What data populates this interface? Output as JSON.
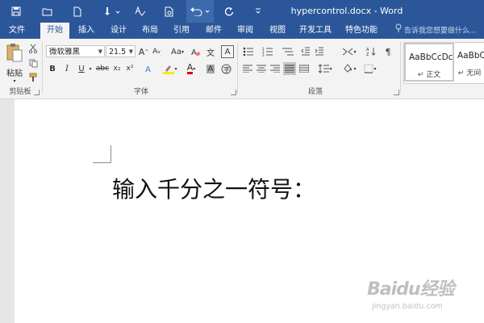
{
  "title_bar": {
    "document_title": "hypercontrol.docx - Word",
    "qat_icons": [
      "save-icon",
      "open-folder-icon",
      "new-document-icon",
      "touch-mode-icon",
      "spelling-icon",
      "print-preview-icon",
      "undo-icon",
      "redo-icon",
      "customize-qat-icon"
    ]
  },
  "tabs": [
    {
      "label": "文件",
      "active": false
    },
    {
      "label": "开始",
      "active": true
    },
    {
      "label": "插入",
      "active": false
    },
    {
      "label": "设计",
      "active": false
    },
    {
      "label": "布局",
      "active": false
    },
    {
      "label": "引用",
      "active": false
    },
    {
      "label": "邮件",
      "active": false
    },
    {
      "label": "审阅",
      "active": false
    },
    {
      "label": "视图",
      "active": false
    },
    {
      "label": "开发工具",
      "active": false
    },
    {
      "label": "特色功能",
      "active": false
    }
  ],
  "tell_me": {
    "placeholder": "告诉我您想要做什么..."
  },
  "ribbon": {
    "clipboard": {
      "paste_label": "粘贴",
      "group_label": "剪贴板"
    },
    "font": {
      "font_name": "微软雅黑",
      "font_size": "21.5",
      "group_label": "字体",
      "grow_label": "A",
      "shrink_label": "A",
      "case_label": "Aa",
      "bold": "B",
      "italic": "I",
      "underline": "U",
      "strike": "abc",
      "subscript": "x₂",
      "superscript": "x²",
      "font_color_label": "A",
      "shading_label": "A",
      "char_border_label": "A",
      "highlight_color": "#ffeb00",
      "font_color": "#e00000"
    },
    "paragraph": {
      "group_label": "段落"
    },
    "styles": [
      {
        "preview": "AaBbCcDc",
        "name": "正文",
        "selected": true
      },
      {
        "preview": "AaBbCc",
        "name": "无间",
        "selected": false
      }
    ]
  },
  "document": {
    "body_text": "输入千分之一符号："
  },
  "watermark": {
    "text": "Baidu经验",
    "url": "jingyan.baidu.com"
  },
  "colors": {
    "brand": "#2b579a",
    "ribbon_bg": "#f3f3f3",
    "workspace": "#e6e6e6"
  }
}
